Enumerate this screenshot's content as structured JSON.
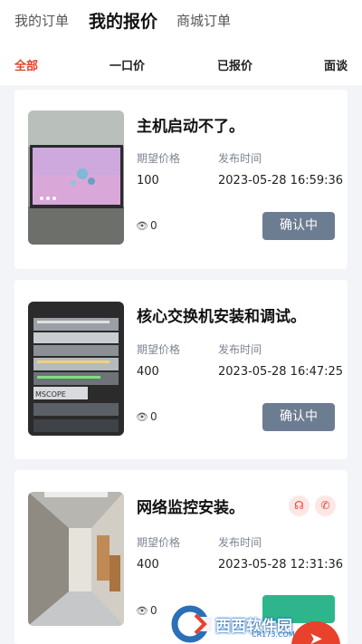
{
  "top_tabs": [
    {
      "label": "我的订单",
      "active": false
    },
    {
      "label": "我的报价",
      "active": true
    },
    {
      "label": "商城订单",
      "active": false
    }
  ],
  "filters": [
    {
      "label": "全部",
      "active": true
    },
    {
      "label": "一口价",
      "active": false
    },
    {
      "label": "已报价",
      "active": false
    },
    {
      "label": "面谈",
      "active": false
    }
  ],
  "colors": {
    "accent": "#e8412c",
    "status_button": "#6c7d92",
    "background": "#f3f4f8"
  },
  "orders": [
    {
      "title": "主机启动不了。",
      "price_label": "期望价格",
      "price": "100",
      "time_label": "发布时间",
      "time": "2023-05-28 16:59:36",
      "views": "0",
      "status": "确认中",
      "thumbnail": "tablet-screen-photo"
    },
    {
      "title": "核心交换机安装和调试。",
      "price_label": "期望价格",
      "price": "400",
      "time_label": "发布时间",
      "time": "2023-05-28 16:47:25",
      "views": "0",
      "status": "确认中",
      "thumbnail": "server-rack-photo"
    },
    {
      "title": "网络监控安装。",
      "price_label": "期望价格",
      "price": "400",
      "time_label": "发布时间",
      "time": "2023-05-28 12:31:36",
      "views": "0",
      "status": "",
      "thumbnail": "hallway-photo",
      "icons": [
        "headset-icon",
        "phone-icon"
      ]
    }
  ],
  "watermark": {
    "text": "西西软件园",
    "url": "CR173.COM"
  }
}
